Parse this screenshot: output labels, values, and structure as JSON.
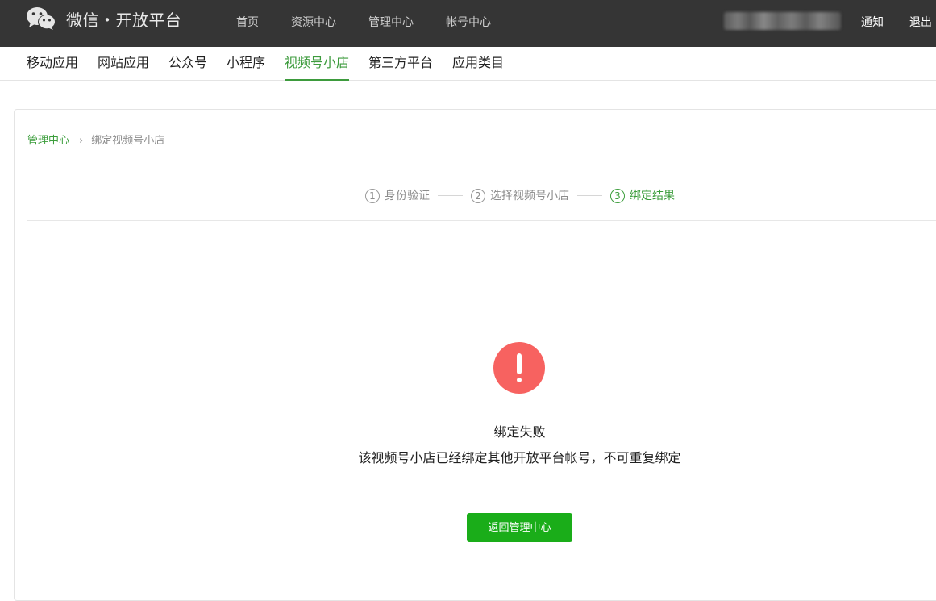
{
  "header": {
    "brand": "微信・开放平台",
    "nav": [
      "首页",
      "资源中心",
      "管理中心",
      "帐号中心"
    ],
    "notify": "通知",
    "logout": "退出"
  },
  "subnav": {
    "tabs": [
      "移动应用",
      "网站应用",
      "公众号",
      "小程序",
      "视频号小店",
      "第三方平台",
      "应用类目"
    ],
    "active_index": 4
  },
  "breadcrumb": {
    "parent": "管理中心",
    "current": "绑定视频号小店"
  },
  "steps": [
    {
      "num": "1",
      "label": "身份验证"
    },
    {
      "num": "2",
      "label": "选择视频号小店"
    },
    {
      "num": "3",
      "label": "绑定结果"
    }
  ],
  "result": {
    "title": "绑定失败",
    "message": "该视频号小店已经绑定其他开放平台帐号，不可重复绑定",
    "button": "返回管理中心"
  },
  "colors": {
    "topbar": "#353535",
    "accent": "#3d9b3d",
    "button": "#1aad19",
    "error": "#f76260"
  },
  "icons": [
    "wechat-logo-icon",
    "chevron-right-icon",
    "exclamation-icon"
  ]
}
